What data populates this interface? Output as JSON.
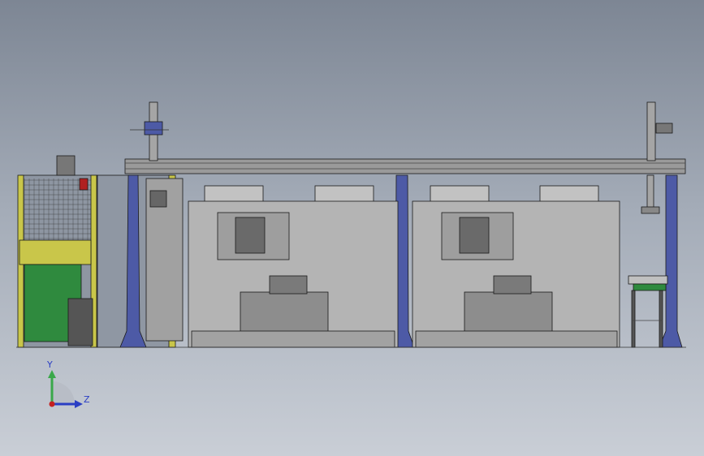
{
  "triad": {
    "y_label": "Y",
    "z_label": "Z"
  },
  "colors": {
    "frame_blue": "#4d5aa6",
    "fence_yellow": "#c9c64a",
    "guard_green": "#2f8a3e",
    "machine_gray": "#b4b4b4",
    "rail_gray": "#9a9a9a",
    "outline": "#1a1a1a",
    "axis_y": "#3aa84a",
    "axis_z": "#2a3ec4",
    "axis_x": "#c42020"
  },
  "icons": [
    "coordinate-triad-icon"
  ]
}
